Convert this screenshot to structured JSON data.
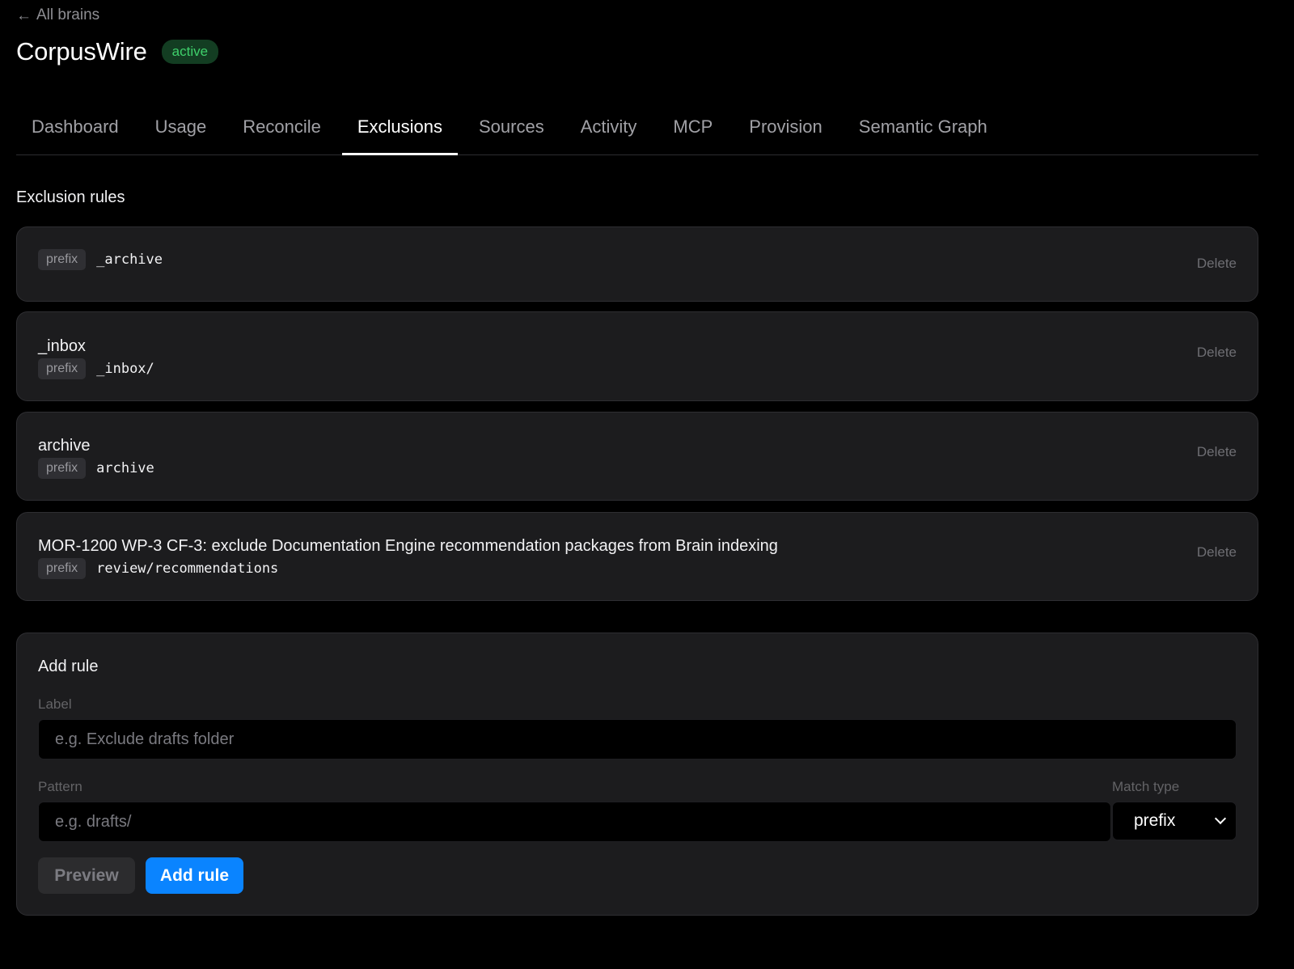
{
  "nav": {
    "back_label": "All brains",
    "back_icon": "arrow-left-icon"
  },
  "header": {
    "title": "CorpusWire",
    "status": "active"
  },
  "tabs": [
    {
      "label": "Dashboard"
    },
    {
      "label": "Usage"
    },
    {
      "label": "Reconcile"
    },
    {
      "label": "Exclusions",
      "active": true
    },
    {
      "label": "Sources"
    },
    {
      "label": "Activity"
    },
    {
      "label": "MCP"
    },
    {
      "label": "Provision"
    },
    {
      "label": "Semantic Graph"
    }
  ],
  "rules_section": {
    "title": "Exclusion rules",
    "delete_label": "Delete",
    "rules": [
      {
        "label": "",
        "match_type": "prefix",
        "pattern": "_archive"
      },
      {
        "label": "_inbox",
        "match_type": "prefix",
        "pattern": "_inbox/"
      },
      {
        "label": "archive",
        "match_type": "prefix",
        "pattern": "archive"
      },
      {
        "label": "MOR-1200 WP-3 CF-3: exclude Documentation Engine recommendation packages from Brain indexing",
        "match_type": "prefix",
        "pattern": "review/recommendations"
      }
    ]
  },
  "add_rule": {
    "title": "Add rule",
    "label_field": {
      "label": "Label",
      "placeholder": "e.g. Exclude drafts folder",
      "value": ""
    },
    "pattern_field": {
      "label": "Pattern",
      "placeholder": "e.g. drafts/",
      "value": ""
    },
    "match_type_field": {
      "label": "Match type",
      "value": "prefix"
    },
    "preview_label": "Preview",
    "submit_label": "Add rule"
  },
  "colors": {
    "accent": "#0a84ff",
    "status_active": "#3fd06b",
    "background": "#000000",
    "card": "#1c1c1e"
  }
}
